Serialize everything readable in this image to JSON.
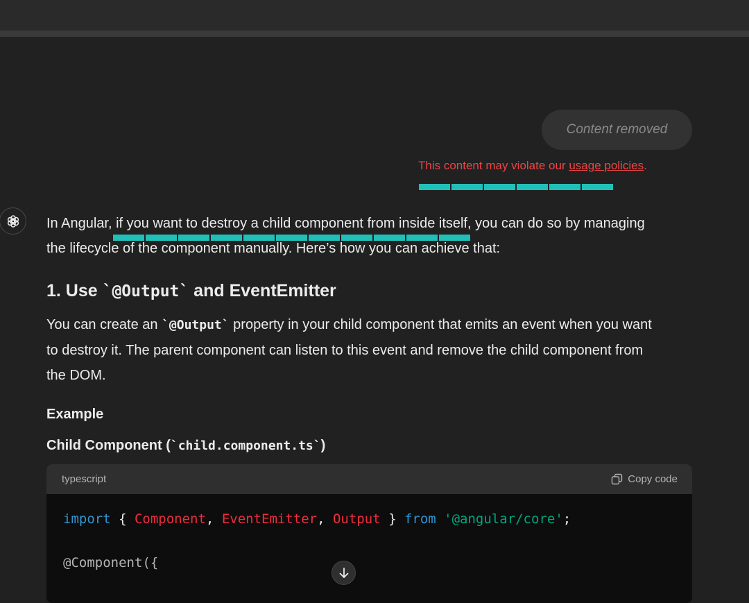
{
  "user_message": {
    "text": "Content removed"
  },
  "policy_warning": {
    "prefix": "This content may violate our ",
    "link": "usage policies",
    "suffix": "."
  },
  "assistant": {
    "intro_line1": "In Angular, if you want to destroy a child component from inside itself, you can do so by managing",
    "intro_line2": "the lifecycle of the component manually. Here’s how you can achieve that:",
    "section1": {
      "number": "1. Use ",
      "code": "`@Output`",
      "rest": " and EventEmitter"
    },
    "para1": {
      "line1_prefix": "You can create an ",
      "line1_code": "`@Output`",
      "line1_suffix": " property in your child component that emits an event when you want",
      "line2": "to destroy it. The parent component can listen to this event and remove the child component from",
      "line3": "the DOM."
    },
    "example_heading": "Example",
    "child_heading": {
      "prefix": "Child Component (",
      "code": "`child.component.ts`",
      "suffix": ")"
    },
    "code_block": {
      "language": "typescript",
      "copy_label": "Copy code",
      "lines": {
        "line1": {
          "import": "import",
          "open": " { ",
          "component": "Component",
          "comma1": ", ",
          "emitter": "EventEmitter",
          "comma2": ", ",
          "output": "Output",
          "close": " } ",
          "from": "from",
          "space": " ",
          "module": "'@angular/core'",
          "semi": ";"
        },
        "line2": "@Component({"
      }
    }
  },
  "colors": {
    "accent_teal": "#20c0b8",
    "warning_red": "#ef4444",
    "keyword_blue": "#2e95d3",
    "class_red": "#f22c3d",
    "string_green": "#00a67d"
  },
  "icons": {
    "avatar": "openai-logo-icon",
    "copy": "copy-icon",
    "scroll": "arrow-down-icon"
  }
}
